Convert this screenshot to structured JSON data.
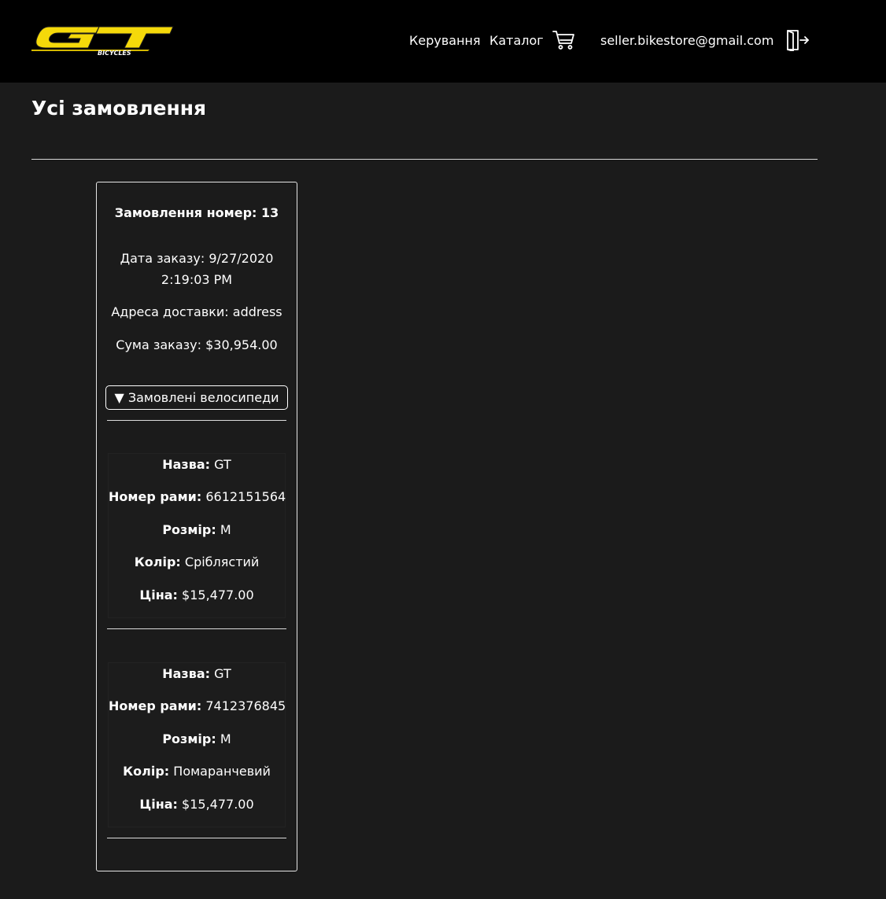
{
  "header": {
    "logo": {
      "text": "GT",
      "subtext": "BICYCLES",
      "icon": "gt-logo",
      "accent": "#f5d90a"
    },
    "nav": [
      {
        "label": "Керування"
      },
      {
        "label": "Каталог"
      }
    ],
    "cart_icon": "cart-icon",
    "user_email": "seller.bikestore@gmail.com",
    "logout_icon": "logout-icon"
  },
  "main": {
    "title": "Усі замовлення",
    "orders": [
      {
        "number_label": "Замовлення номер: 13",
        "date_line1": "Дата заказу: 9/27/2020",
        "date_line2": "2:19:03 PM",
        "address": "Адреса доставки: address",
        "total": "Сума заказу: $30,954.00",
        "toggle_label": "▼ Замовлені велосипеди",
        "bikes": [
          {
            "name_label": "Назва:",
            "name_value": "GT",
            "frame_label": "Номер рами:",
            "frame_value": "6612151564",
            "size_label": "Розмір:",
            "size_value": "M",
            "color_label": "Колір:",
            "color_value": "Сріблястий",
            "price_label": "Ціна:",
            "price_value": "$15,477.00"
          },
          {
            "name_label": "Назва:",
            "name_value": "GT",
            "frame_label": "Номер рами:",
            "frame_value": "7412376845",
            "size_label": "Розмір:",
            "size_value": "M",
            "color_label": "Колір:",
            "color_value": "Помаранчевий",
            "price_label": "Ціна:",
            "price_value": "$15,477.00"
          }
        ]
      }
    ]
  }
}
